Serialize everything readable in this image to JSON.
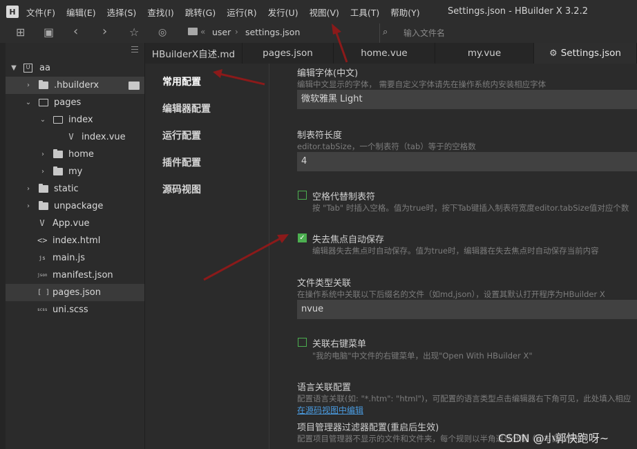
{
  "menubar": {
    "logo": "H",
    "items": [
      "文件(F)",
      "编辑(E)",
      "选择(S)",
      "查找(I)",
      "跳转(G)",
      "运行(R)",
      "发行(U)",
      "视图(V)",
      "工具(T)",
      "帮助(Y)"
    ],
    "window_title": "Settings.json - HBuilder X 3.2.2"
  },
  "toolbar": {
    "breadcrumb": [
      "user",
      "settings.json"
    ],
    "search_placeholder": "输入文件名"
  },
  "sidebar": {
    "tree": [
      {
        "label": "aa",
        "type": "project",
        "expanded": true
      },
      {
        "label": ".hbuilderx",
        "type": "folder",
        "expanded": false
      },
      {
        "label": "pages",
        "type": "folder",
        "expanded": true
      },
      {
        "label": "index",
        "type": "folder",
        "expanded": true
      },
      {
        "label": "index.vue",
        "type": "file",
        "icon": "V"
      },
      {
        "label": "home",
        "type": "folder",
        "expanded": false
      },
      {
        "label": "my",
        "type": "folder",
        "expanded": false
      },
      {
        "label": "static",
        "type": "folder",
        "expanded": false
      },
      {
        "label": "unpackage",
        "type": "folder",
        "expanded": false
      },
      {
        "label": "App.vue",
        "type": "file",
        "icon": "V"
      },
      {
        "label": "index.html",
        "type": "file",
        "icon": "<>"
      },
      {
        "label": "main.js",
        "type": "file",
        "icon": "js"
      },
      {
        "label": "manifest.json",
        "type": "file",
        "icon": "json"
      },
      {
        "label": "pages.json",
        "type": "file",
        "icon": "[ ]"
      },
      {
        "label": "uni.scss",
        "type": "file",
        "icon": "scss"
      }
    ]
  },
  "tabs": [
    "HBuilderX自述.md",
    "pages.json",
    "home.vue",
    "my.vue",
    "Settings.json"
  ],
  "settings_nav": [
    "常用配置",
    "编辑器配置",
    "运行配置",
    "插件配置",
    "源码视图"
  ],
  "settings": {
    "font": {
      "title": "编辑字体(中文)",
      "desc": "编辑中文显示的字体， 需要自定义字体请先在操作系统内安装相应字体",
      "value": "微软雅黑 Light"
    },
    "tabsize": {
      "title": "制表符长度",
      "desc": "editor.tabSize，一个制表符（tab）等于的空格数",
      "value": "4"
    },
    "insert_spaces": {
      "label": "空格代替制表符",
      "desc": "按 \"Tab\" 时插入空格。值为true时，按下Tab键插入制表符宽度editor.tabSize值对应个数",
      "checked": false
    },
    "autosave": {
      "label": "失去焦点自动保存",
      "desc": "编辑器失去焦点时自动保存。值为true时，编辑器在失去焦点时自动保存当前内容",
      "checked": true
    },
    "file_assoc": {
      "title": "文件类型关联",
      "desc": "在操作系统中关联以下后缀名的文件（如md,json），设置其默认打开程序为HBuilder X",
      "value": "nvue"
    },
    "context_menu": {
      "label": "关联右键菜单",
      "desc": "\"我的电脑\"中文件的右键菜单，出现\"Open With HBuilder X\"",
      "checked": false
    },
    "lang_assoc": {
      "title": "语言关联配置",
      "desc": "配置语言关联(如: \"*.htm\": \"html\")，可配置的语言类型点击编辑器右下角可见，此处填入相应",
      "link": "在源码视图中编辑"
    },
    "project_filter": {
      "title": "项目管理器过滤器配置(重启后生效)",
      "desc": "配置项目管理器不显示的文件和文件夹，每个规则以半角逗号分隔（回车自动添加"
    }
  },
  "watermark": "CSDN @小郭快跑呀~",
  "colors": {
    "background": "#2b2b2b",
    "check_green": "#4caf50",
    "link_blue": "#4a9be0",
    "annotation_arrow": "#8b1a1a"
  }
}
